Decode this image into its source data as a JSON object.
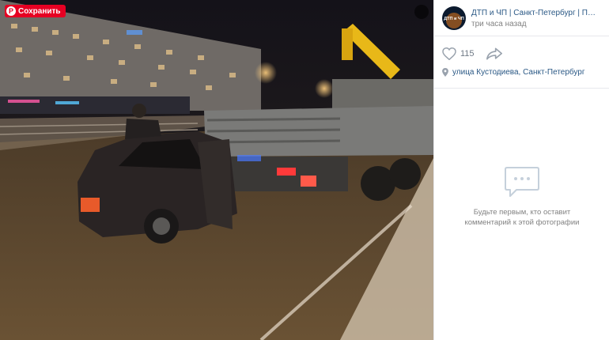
{
  "photo": {
    "save_label": "Сохранить",
    "save_icon": "pinterest-p-icon",
    "zoom_icon": "zoom-icon"
  },
  "post": {
    "group_name": "ДТП и ЧП | Санкт-Петербург | Питер Онлайн | СПб",
    "avatar_text": "ДТП и ЧП",
    "time": "три часа назад",
    "likes": "115",
    "location": "улица Кустодиева, Санкт-Петербург"
  },
  "comments": {
    "empty_line1": "Будьте первым, кто оставит",
    "empty_line2": "комментарий к этой фотографии"
  },
  "colors": {
    "accent": "#2a5885",
    "muted": "#828282",
    "save_red": "#e60023",
    "divider": "#e7e8ec"
  }
}
